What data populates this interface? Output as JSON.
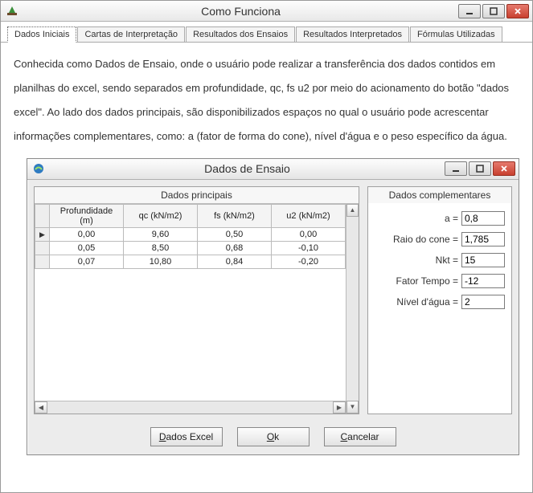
{
  "outer": {
    "title": "Como Funciona"
  },
  "tabs": [
    {
      "label": "Dados Iniciais",
      "active": true
    },
    {
      "label": "Cartas de Interpretação",
      "active": false
    },
    {
      "label": "Resultados dos Ensaios",
      "active": false
    },
    {
      "label": "Resultados Interpretados",
      "active": false
    },
    {
      "label": "Fórmulas Utilizadas",
      "active": false
    }
  ],
  "paragraph": "Conhecida como Dados de Ensaio, onde o usuário pode realizar a transferência dos dados contidos em planilhas do excel, sendo separados em profundidade, qc, fs u2 por meio do acionamento do botão \"dados excel\". Ao lado dos dados principais, são disponibilizados espaços no qual o usuário pode acrescentar informações complementares, como: a (fator de forma do cone), nível d'água e o peso específico da água.",
  "inner": {
    "title": "Dados de Ensaio"
  },
  "main_data": {
    "title": "Dados principais",
    "columns": [
      "Profundidade (m)",
      "qc (kN/m2)",
      "fs (kN/m2)",
      "u2 (kN/m2)"
    ],
    "rows": [
      {
        "cells": [
          "0,00",
          "9,60",
          "0,50",
          "0,00"
        ],
        "current": true
      },
      {
        "cells": [
          "0,05",
          "8,50",
          "0,68",
          "-0,10"
        ],
        "current": false
      },
      {
        "cells": [
          "0,07",
          "10,80",
          "0,84",
          "-0,20"
        ],
        "current": false
      }
    ]
  },
  "comp_data": {
    "title": "Dados complementares",
    "fields": [
      {
        "label": "a =",
        "value": "0,8"
      },
      {
        "label": "Raio do cone =",
        "value": "1,785"
      },
      {
        "label": "Nkt =",
        "value": "15"
      },
      {
        "label": "Fator Tempo =",
        "value": "-12"
      },
      {
        "label": "Nível d'água =",
        "value": "2"
      }
    ]
  },
  "buttons": {
    "excel": "Dados Excel",
    "ok": "Ok",
    "cancel": "Cancelar"
  }
}
